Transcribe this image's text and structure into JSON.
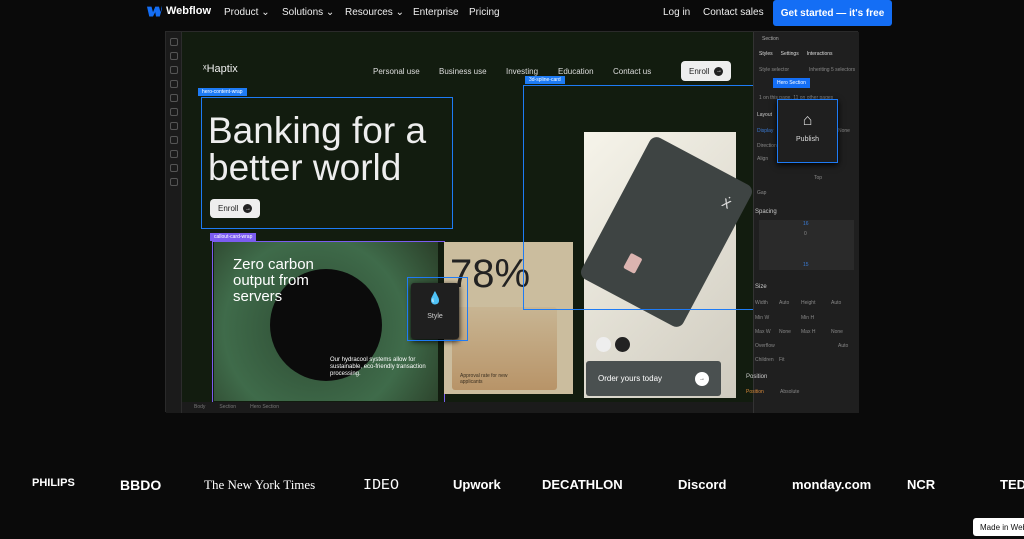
{
  "topnav": {
    "brand": "Webflow",
    "items": [
      "Product",
      "Solutions",
      "Resources",
      "Enterprise",
      "Pricing"
    ],
    "login": "Log in",
    "contact": "Contact sales",
    "cta": "Get started — it's free",
    "accent": "#146ef5"
  },
  "site": {
    "brand": "Haptix",
    "nav": [
      "Personal use",
      "Business use",
      "Investing",
      "Education",
      "Contact us"
    ],
    "enroll": "Enroll",
    "hero_title_1": "Banking for a",
    "hero_title_2": "better world",
    "hero_enroll": "Enroll",
    "callout_title": "Zero carbon output from servers",
    "callout_body": "Our hydracool systems allow for sustainable, eco-friendly transaction processing.",
    "stat": "78%",
    "stat_label": "Approval rate for new applicants",
    "order": "Order yours today"
  },
  "overlays": {
    "hero_tag": "hero-content-wrap",
    "spline_tag": "3d-spline-card",
    "callout_tag": "callout-card-wrap",
    "style_label": "Style",
    "publish_label": "Publish",
    "selection_color": "#1e7bf5",
    "callout_color": "#7b5cf0"
  },
  "panel": {
    "element": "Section",
    "tabs": [
      "Styles",
      "Settings",
      "Interactions"
    ],
    "selector_label": "Style selector",
    "inheriting": "Inheriting 5 selectors",
    "class": "Hero Section",
    "usage": "1 on this page, 11 on other pages",
    "layout": "Layout",
    "display": "Display",
    "direction": "Direction",
    "align": "Align",
    "gap": "Gap",
    "top": "Top",
    "none": "None",
    "spacing": "Spacing",
    "margin_top": "16",
    "margin_bottom": "15",
    "padding": "0",
    "size": "Size",
    "width": "Width",
    "height": "Height",
    "auto": "Auto",
    "minw": "Min W",
    "minh": "Min H",
    "maxw": "Max W",
    "maxh": "Max H",
    "overflow": "Overflow",
    "children": "Children",
    "fit": "Fit",
    "position": "Position",
    "position_value": "Absolute"
  },
  "breadcrumb": [
    "Body",
    "Section",
    "Hero Section"
  ],
  "logos": [
    "PHILIPS",
    "BBDO",
    "The New York Times",
    "IDEO",
    "Upwork",
    "DECATHLON",
    "Discord",
    "monday.com",
    "NCR",
    "TED"
  ],
  "badge": "Made in Webflow"
}
